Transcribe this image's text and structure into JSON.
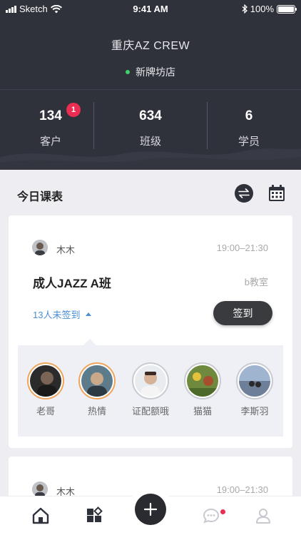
{
  "status_bar": {
    "carrier": "Sketch",
    "time": "9:41 AM",
    "battery": "100%"
  },
  "header": {
    "title": "重庆AZ CREW",
    "store": "新牌坊店",
    "stats": [
      {
        "value": "134",
        "label": "客户",
        "badge": "1"
      },
      {
        "value": "634",
        "label": "班级"
      },
      {
        "value": "6",
        "label": "学员"
      }
    ]
  },
  "schedule": {
    "title": "今日课表",
    "icons": {
      "swap": "swap-icon",
      "calendar": "calendar-icon"
    }
  },
  "cards": [
    {
      "teacher": "木木",
      "time": "19:00–21:30",
      "class_name": "成人JAZZ A班",
      "room": "b教室",
      "unsigned": "13人未签到",
      "signin_label": "签到",
      "students": [
        {
          "name": "老哥",
          "active": true
        },
        {
          "name": "热情",
          "active": true
        },
        {
          "name": "证配额哦",
          "active": false
        },
        {
          "name": "猫猫",
          "active": false
        },
        {
          "name": "李斯羽",
          "active": false
        }
      ]
    },
    {
      "teacher": "木木",
      "time": "19:00–21:30"
    }
  ],
  "tabbar": {
    "icons": [
      "home-icon",
      "apps-icon",
      "add-icon",
      "message-icon",
      "user-icon"
    ],
    "colors": {
      "active": "#2f313b",
      "inactive": "#c8c9cf",
      "badge": "#ea2d50"
    }
  }
}
